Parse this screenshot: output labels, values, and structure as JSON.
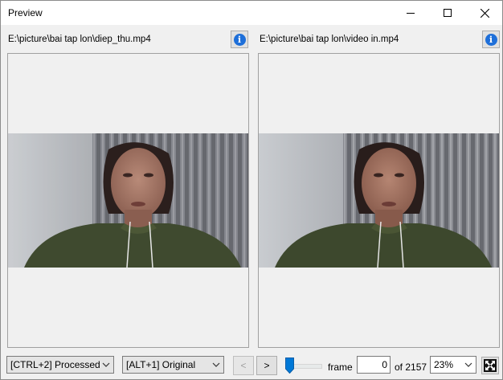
{
  "window": {
    "title": "Preview"
  },
  "left_pane": {
    "path": "E:\\picture\\bai tap lon\\diep_thu.mp4",
    "info_icon": "info-icon"
  },
  "right_pane": {
    "path": "E:\\picture\\bai tap lon\\video in.mp4",
    "info_icon": "info-icon"
  },
  "bottom": {
    "left_view_mode": "[CTRL+2] Processed",
    "right_view_mode": "[ALT+1] Original",
    "prev_label": "<",
    "next_label": ">",
    "seek_position": 0,
    "frame_label": "frame",
    "frame_value": "0",
    "of_total": "of 2157",
    "zoom": "23%"
  },
  "icons": [
    "minimize-icon",
    "maximize-icon",
    "close-icon",
    "info-icon",
    "chevron-down-icon",
    "fullscreen-icon"
  ]
}
